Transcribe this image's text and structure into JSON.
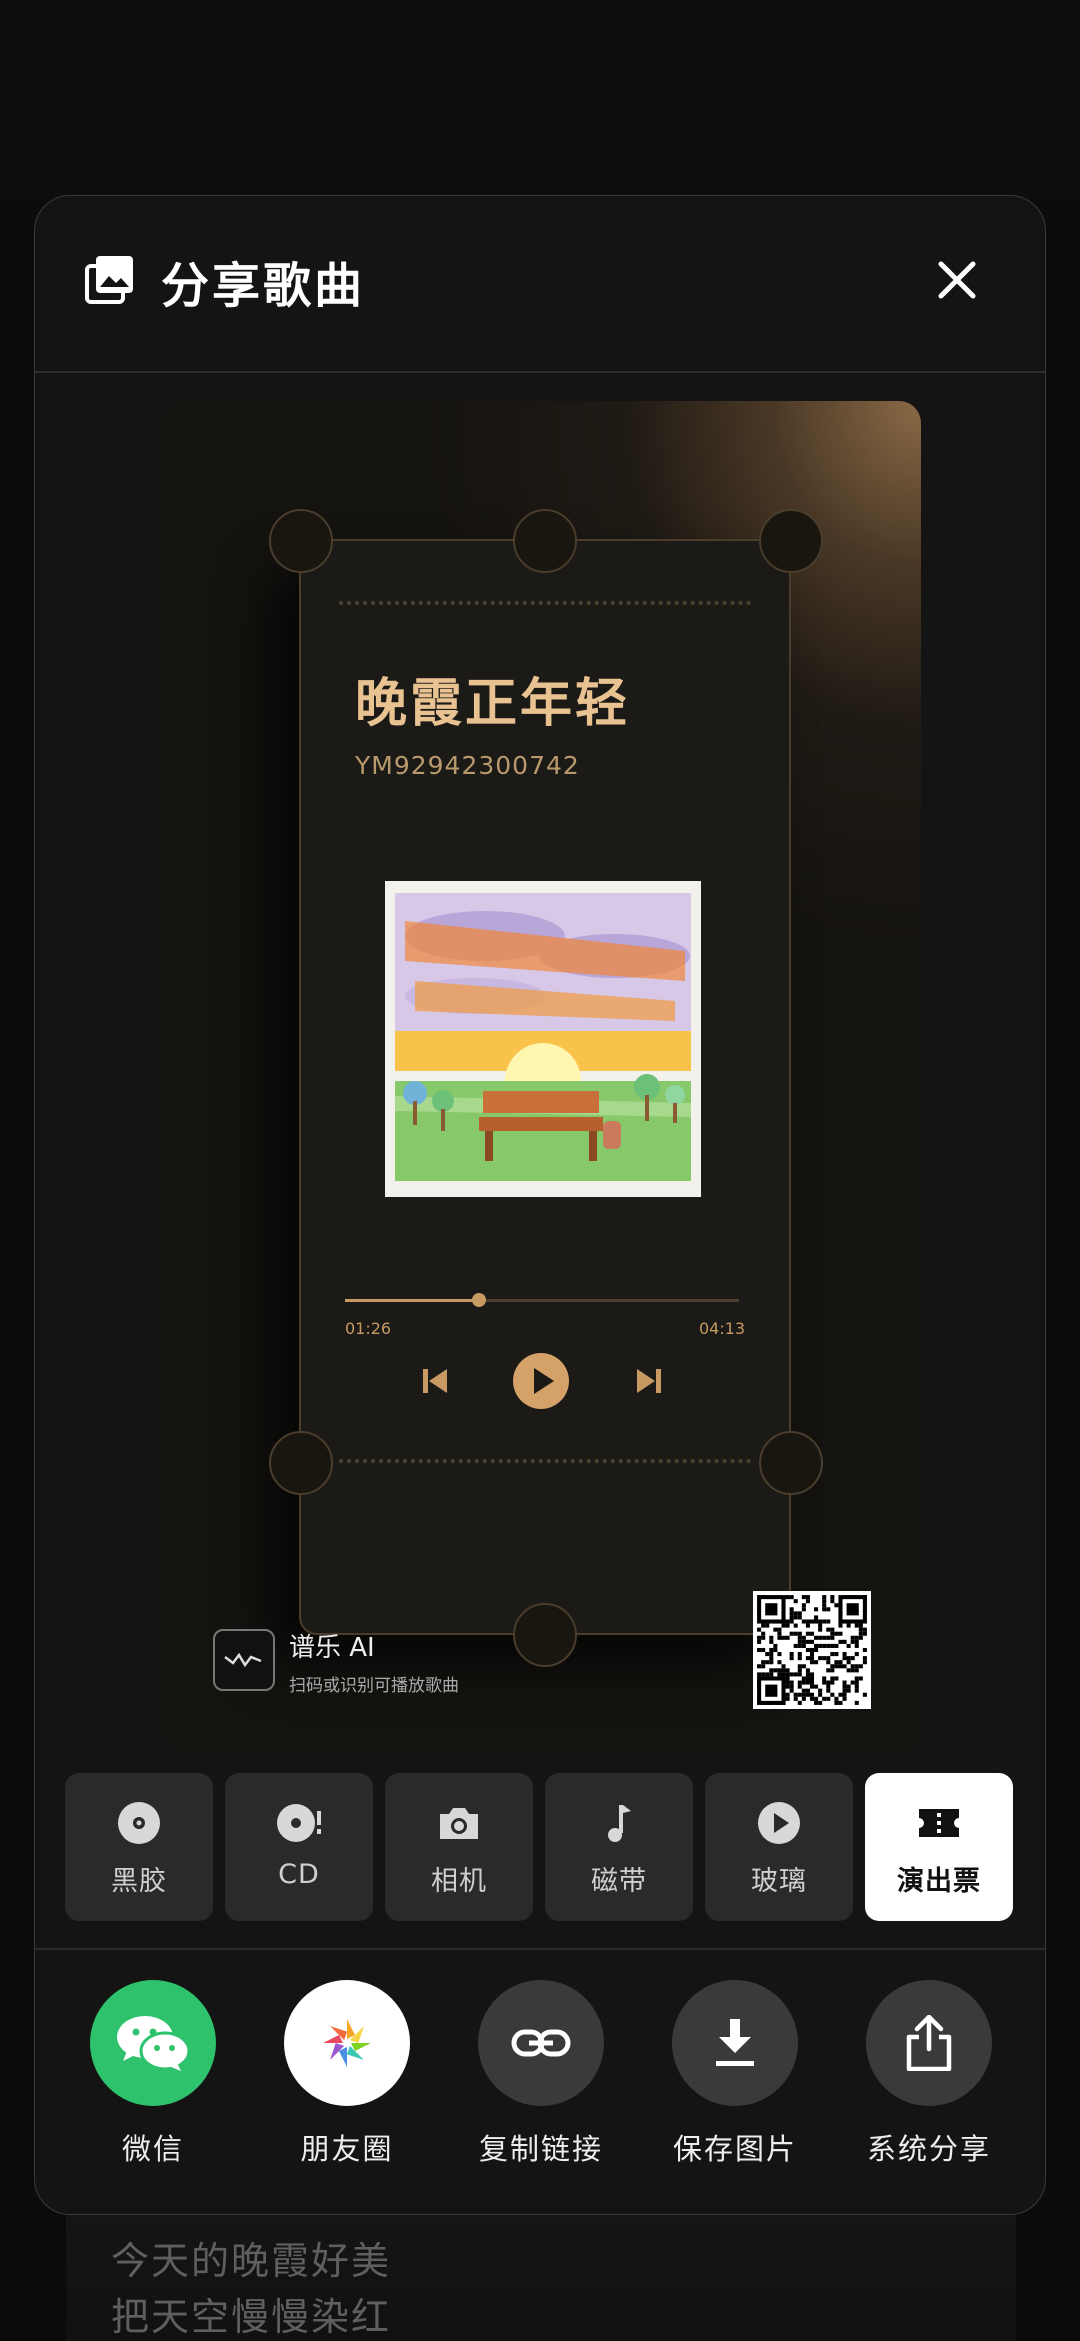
{
  "header": {
    "title": "分享歌曲"
  },
  "card": {
    "song_title": "晚霞正年轻",
    "song_id": "YM92942300742",
    "time_current": "01:26",
    "time_total": "04:13",
    "progress": 0.34,
    "brand_name": "谱乐 AI",
    "brand_sub": "扫码或识别可播放歌曲"
  },
  "styles": [
    {
      "label": "黑胶",
      "icon": "vinyl-icon",
      "active": false
    },
    {
      "label": "CD",
      "icon": "cd-icon",
      "active": false
    },
    {
      "label": "相机",
      "icon": "camera-icon",
      "active": false
    },
    {
      "label": "磁带",
      "icon": "music-note-icon",
      "active": false
    },
    {
      "label": "玻璃",
      "icon": "play-circle-icon",
      "active": false
    },
    {
      "label": "演出票",
      "icon": "ticket-icon",
      "active": true
    }
  ],
  "share": [
    {
      "label": "微信",
      "icon": "wechat-icon",
      "color": "#2dc26b"
    },
    {
      "label": "朋友圈",
      "icon": "moments-icon",
      "color": "#ffffff"
    },
    {
      "label": "复制链接",
      "icon": "link-icon",
      "color": "#3a3a3a"
    },
    {
      "label": "保存图片",
      "icon": "download-icon",
      "color": "#3a3a3a"
    },
    {
      "label": "系统分享",
      "icon": "share-icon",
      "color": "#3a3a3a"
    }
  ],
  "lyrics": [
    "今天的晚霞好美",
    "把天空慢慢染红"
  ]
}
